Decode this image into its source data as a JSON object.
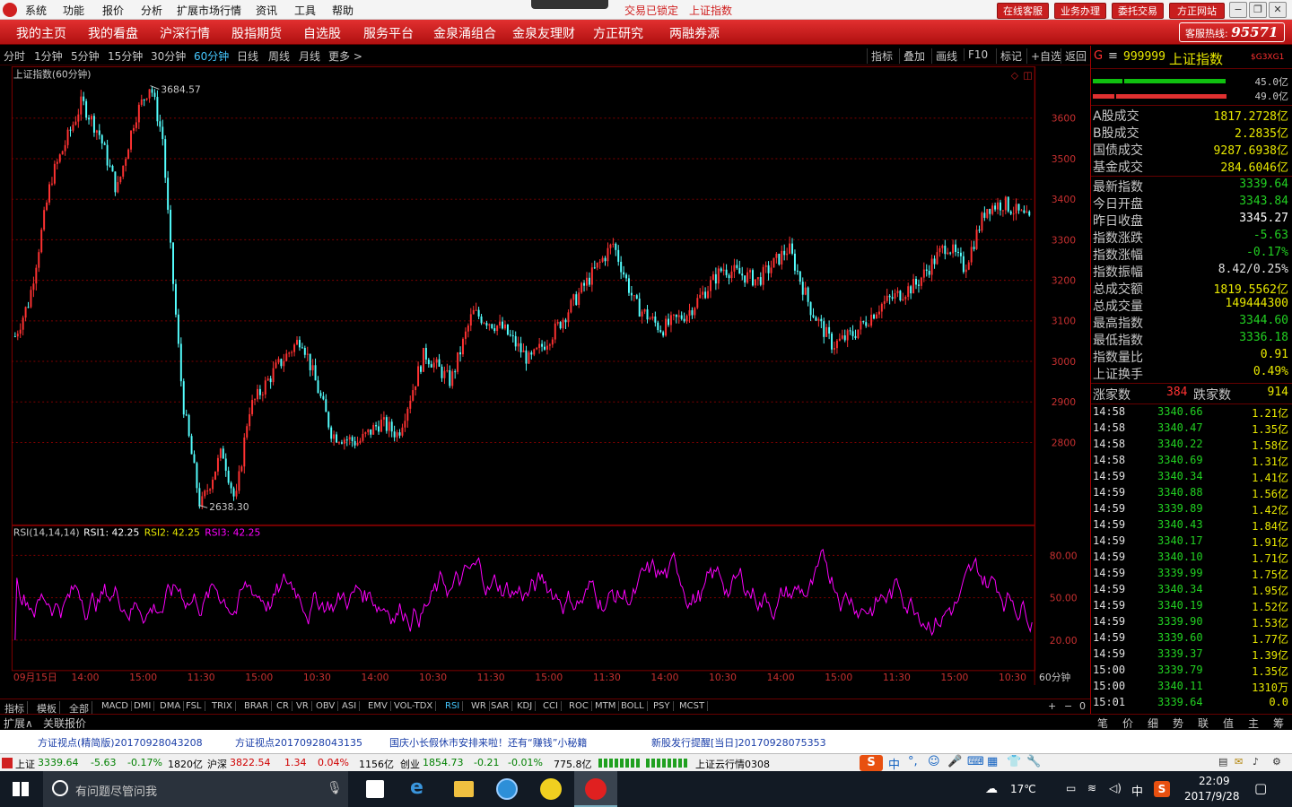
{
  "titlebar": {
    "menus": [
      "系统",
      "功能",
      "报价",
      "分析",
      "扩展市场行情",
      "资讯",
      "工具",
      "帮助"
    ],
    "trade_status": "交易已锁定",
    "current_security": "上证指数",
    "buttons": [
      "在线客服",
      "业务办理",
      "委托交易",
      "方正网站"
    ]
  },
  "nav": {
    "items": [
      "我的主页",
      "我的看盘",
      "沪深行情",
      "股指期货",
      "自选股",
      "服务平台",
      "金泉涌组合",
      "金泉友理财",
      "方正研究",
      "两融券源"
    ],
    "hotline_label": "客服热线:",
    "hotline_number": "95571"
  },
  "periods": {
    "items": [
      "分时",
      "1分钟",
      "5分钟",
      "15分钟",
      "30分钟",
      "60分钟",
      "日线",
      "周线",
      "月线",
      "更多 >"
    ],
    "active": "60分钟"
  },
  "tools": [
    "指标",
    "叠加",
    "画线",
    "F10",
    "标记",
    "+自选",
    "返回"
  ],
  "chart": {
    "title": "上证指数(60分钟)",
    "high_marker": "3684.57",
    "low_marker": "2638.30",
    "y_ticks": [
      "3600",
      "3500",
      "3400",
      "3300",
      "3200",
      "3100",
      "3000",
      "2900",
      "2800"
    ],
    "rsi_header": "RSI(14,14,14)",
    "rsi1": "RSI1: 42.25",
    "rsi2": "RSI2: 42.25",
    "rsi3": "RSI3: 42.25",
    "rsi_ticks": [
      "80.00",
      "50.00",
      "20.00"
    ],
    "x_labels": [
      "09月15日",
      "14:00",
      "15:00",
      "11:30",
      "15:00",
      "10:30",
      "14:00",
      "10:30",
      "11:30",
      "15:00",
      "11:30",
      "14:00",
      "10:30",
      "14:00",
      "15:00",
      "11:30",
      "15:00",
      "10:30"
    ],
    "x_unit": "60分钟",
    "colors": {
      "up": "#ff3232",
      "down": "#54ffff",
      "rsi": "#ff00ff",
      "grid": "#800000"
    }
  },
  "indicators": [
    "指标",
    "模板",
    "全部",
    "MACD",
    "DMI",
    "DMA",
    "FSL",
    "TRIX",
    "BRAR",
    "CR",
    "VR",
    "OBV",
    "ASI",
    "EMV",
    "VOL-TDX",
    "RSI",
    "WR",
    "SAR",
    "KDJ",
    "CCI",
    "ROC",
    "MTM",
    "BOLL",
    "PSY",
    "MCST"
  ],
  "active_indicator": "RSI",
  "bottom_tabs": [
    "扩展∧",
    "关联报价"
  ],
  "zoom_controls": [
    "+",
    "−",
    "0"
  ],
  "right_panel": {
    "code": "999999",
    "name": "上证指数",
    "badge": "$G3XG1",
    "bar1_value": "45.0亿",
    "bar2_value": "49.0亿",
    "market_rows": [
      {
        "k": "A股成交",
        "v": "1817.2728亿"
      },
      {
        "k": "B股成交",
        "v": "2.2835亿"
      },
      {
        "k": "国债成交",
        "v": "9287.6938亿"
      },
      {
        "k": "基金成交",
        "v": "284.6046亿"
      }
    ],
    "index_rows": [
      {
        "k": "最新指数",
        "v": "3339.64",
        "c": "#22d022"
      },
      {
        "k": "今日开盘",
        "v": "3343.84",
        "c": "#22d022"
      },
      {
        "k": "昨日收盘",
        "v": "3345.27",
        "c": "#ffffff"
      },
      {
        "k": "指数涨跌",
        "v": "-5.63",
        "c": "#22d022"
      },
      {
        "k": "指数涨幅",
        "v": "-0.17%",
        "c": "#22d022"
      },
      {
        "k": "指数振幅",
        "v": "8.42/0.25%",
        "c": "#e0e0e0"
      },
      {
        "k": "总成交额",
        "v": "1819.5562亿",
        "c": "#e8e800"
      },
      {
        "k": "总成交量",
        "v": "149444300",
        "c": "#e8e800"
      },
      {
        "k": "最高指数",
        "v": "3344.60",
        "c": "#22d022"
      },
      {
        "k": "最低指数",
        "v": "3336.18",
        "c": "#22d022"
      },
      {
        "k": "指数量比",
        "v": "0.91",
        "c": "#e8e800"
      },
      {
        "k": "上证换手",
        "v": "0.49%",
        "c": "#e8e800"
      }
    ],
    "up_label": "涨家数",
    "up_count": "384",
    "down_label": "跌家数",
    "down_count": "914",
    "ticks": [
      {
        "t": "14:58",
        "p": "3340.66",
        "v": "1.21亿"
      },
      {
        "t": "14:58",
        "p": "3340.47",
        "v": "1.35亿"
      },
      {
        "t": "14:58",
        "p": "3340.22",
        "v": "1.58亿"
      },
      {
        "t": "14:58",
        "p": "3340.69",
        "v": "1.31亿"
      },
      {
        "t": "14:59",
        "p": "3340.34",
        "v": "1.41亿"
      },
      {
        "t": "14:59",
        "p": "3340.88",
        "v": "1.56亿"
      },
      {
        "t": "14:59",
        "p": "3339.89",
        "v": "1.42亿"
      },
      {
        "t": "14:59",
        "p": "3340.43",
        "v": "1.84亿"
      },
      {
        "t": "14:59",
        "p": "3340.17",
        "v": "1.91亿"
      },
      {
        "t": "14:59",
        "p": "3340.10",
        "v": "1.71亿"
      },
      {
        "t": "14:59",
        "p": "3339.99",
        "v": "1.75亿"
      },
      {
        "t": "14:59",
        "p": "3340.34",
        "v": "1.95亿"
      },
      {
        "t": "14:59",
        "p": "3340.19",
        "v": "1.52亿"
      },
      {
        "t": "14:59",
        "p": "3339.90",
        "v": "1.53亿"
      },
      {
        "t": "14:59",
        "p": "3339.60",
        "v": "1.77亿"
      },
      {
        "t": "14:59",
        "p": "3339.37",
        "v": "1.39亿"
      },
      {
        "t": "15:00",
        "p": "3339.79",
        "v": "1.35亿"
      },
      {
        "t": "15:00",
        "p": "3340.11",
        "v": "1310万"
      },
      {
        "t": "15:01",
        "p": "3339.64",
        "v": "0.0"
      }
    ],
    "tabs": [
      "笔",
      "价",
      "细",
      "势",
      "联",
      "值",
      "主",
      "筹"
    ]
  },
  "news": [
    "方证视点(精简版)20170928043208",
    "方证视点20170928043135",
    "国庆小长假休市安排来啦！还有“赚钱”小秘籍",
    "新股发行提醒[当日]20170928075353"
  ],
  "status": {
    "sh_label": "上证",
    "sh_price": "3339.64",
    "sh_chg": "-5.63",
    "sh_pct": "-0.17%",
    "sh_amt": "1820亿",
    "hs_label": "沪深",
    "hs_price": "3822.54",
    "hs_chg": "1.34",
    "hs_pct": "0.04%",
    "hs_amt": "1156亿",
    "cy_label": "创业",
    "cy_price": "1854.73",
    "cy_chg": "-0.21",
    "cy_pct": "-0.01%",
    "cy_amt": "775.8亿",
    "cloud": "上证云行情0308",
    "ime": "中"
  },
  "taskbar": {
    "search_placeholder": "有问题尽管问我",
    "weather": "17℃",
    "ime": "中",
    "time": "22:09",
    "date": "2017/9/28"
  }
}
